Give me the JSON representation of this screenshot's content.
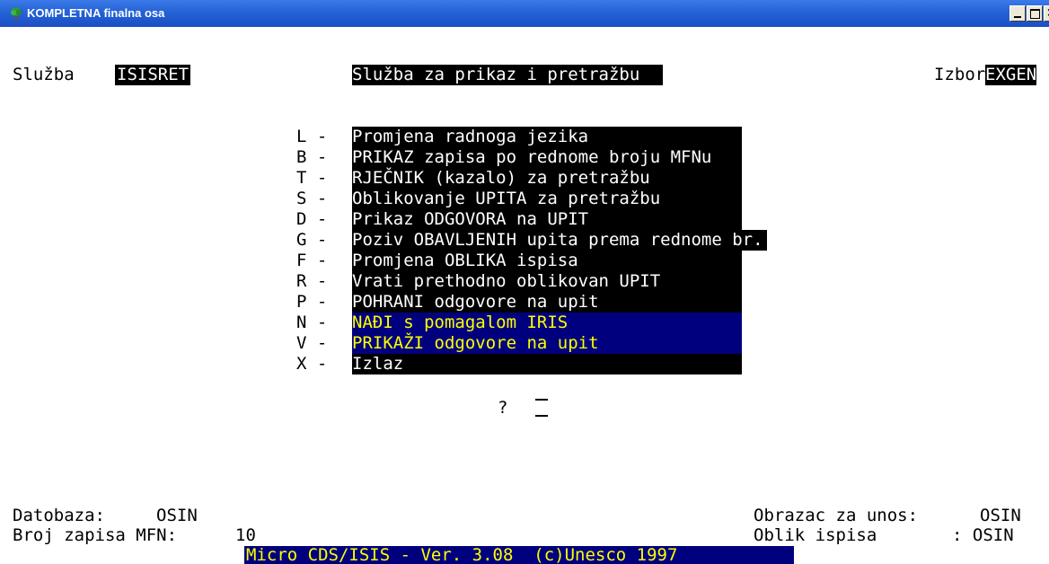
{
  "window": {
    "title": "KOMPLETNA finalna osa",
    "icon": "tree-icon",
    "controls": [
      "minimize",
      "maximize",
      "close"
    ]
  },
  "header": {
    "sluzba_label": "Služba",
    "sluzba_value": "ISISRET",
    "center_title": "Služba za prikaz i pretražbu",
    "izbor_label": "Izbor",
    "izbor_value": "EXGEN"
  },
  "menu": {
    "items": [
      {
        "key": "L",
        "label": "Promjena radnoga jezika"
      },
      {
        "key": "B",
        "label": "PRIKAZ zapisa po rednome broju MFNu"
      },
      {
        "key": "T",
        "label": "RJEČNIK (kazalo) za pretražbu"
      },
      {
        "key": "S",
        "label": "Oblikovanje UPITA za pretražbu"
      },
      {
        "key": "D",
        "label": "Prikaz ODGOVORA na UPIT"
      },
      {
        "key": "G",
        "label": "Poziv OBAVLJENIH upita prema rednome br."
      },
      {
        "key": "F",
        "label": "Promjena OBLIKA ispisa"
      },
      {
        "key": "R",
        "label": "Vrati prethodno oblikovan UPIT"
      },
      {
        "key": "P",
        "label": "POHRANI odgovore na upit"
      },
      {
        "key": "N",
        "label": "NAĐI s pomagalom IRIS"
      },
      {
        "key": "V",
        "label": "PRIKAŽI odgovore na upit"
      },
      {
        "key": "X",
        "label": "Izlaz"
      }
    ],
    "separator": " - "
  },
  "prompt": {
    "symbol": "?"
  },
  "status": {
    "database_label": "Datobaza:",
    "database_value": "OSIN",
    "records_label": "Broj zapisa MFN:",
    "records_value": "10",
    "entry_form_label": "Obrazac za unos:",
    "entry_form_value": "OSIN",
    "print_format_label": "Oblik ispisa",
    "print_format_value": ": OSIN"
  },
  "footer": {
    "text": "Micro CDS/ISIS - Ver. 3.08  (c)Unesco 1997"
  },
  "colors": {
    "titlebar": "#2462d6",
    "highlight_bg": "#00007f",
    "highlight_fg": "#ffff00",
    "inverse_bg": "#000000",
    "inverse_fg": "#ffffff"
  }
}
